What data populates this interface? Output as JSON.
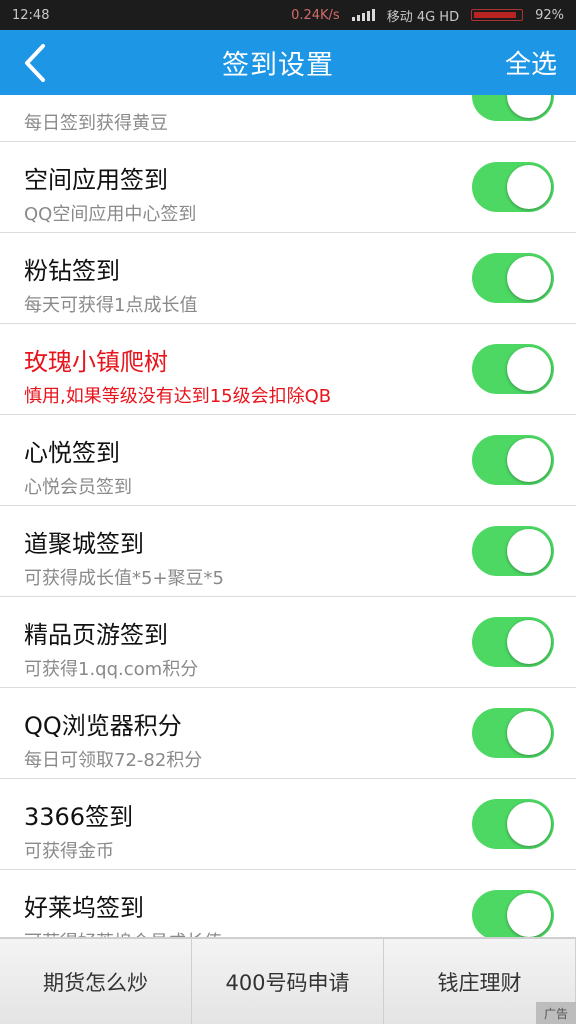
{
  "status": {
    "time": "12:48",
    "speed": "0.24K/s",
    "carrier": "移动 4G HD",
    "battery": "92%",
    "battery_level": 0.92
  },
  "header": {
    "back_icon": "chevron-left-icon",
    "title": "签到设置",
    "select_all": "全选"
  },
  "items": [
    {
      "title": "",
      "subtitle": "每日签到获得黄豆",
      "enabled": true
    },
    {
      "title": "空间应用签到",
      "subtitle": "QQ空间应用中心签到",
      "enabled": true
    },
    {
      "title": "粉钻签到",
      "subtitle": "每天可获得1点成长值",
      "enabled": true
    },
    {
      "title": "玫瑰小镇爬树",
      "subtitle": "慎用,如果等级没有达到15级会扣除QB",
      "enabled": true,
      "warning": true
    },
    {
      "title": "心悦签到",
      "subtitle": "心悦会员签到",
      "enabled": true
    },
    {
      "title": "道聚城签到",
      "subtitle": "可获得成长值*5+聚豆*5",
      "enabled": true
    },
    {
      "title": "精品页游签到",
      "subtitle": "可获得1.qq.com积分",
      "enabled": true
    },
    {
      "title": "QQ浏览器积分",
      "subtitle": "每日可领取72-82积分",
      "enabled": true
    },
    {
      "title": "3366签到",
      "subtitle": "可获得金币",
      "enabled": true
    },
    {
      "title": "好莱坞签到",
      "subtitle": "可获得好莱坞会员成长值",
      "enabled": true
    }
  ],
  "ad": {
    "buttons": [
      "期货怎么炒",
      "400号码申请",
      "钱庄理财"
    ],
    "tag": "广告"
  },
  "colors": {
    "header": "#1e96e6",
    "toggle_on": "#4cd863",
    "warning_text": "#e8141c"
  }
}
